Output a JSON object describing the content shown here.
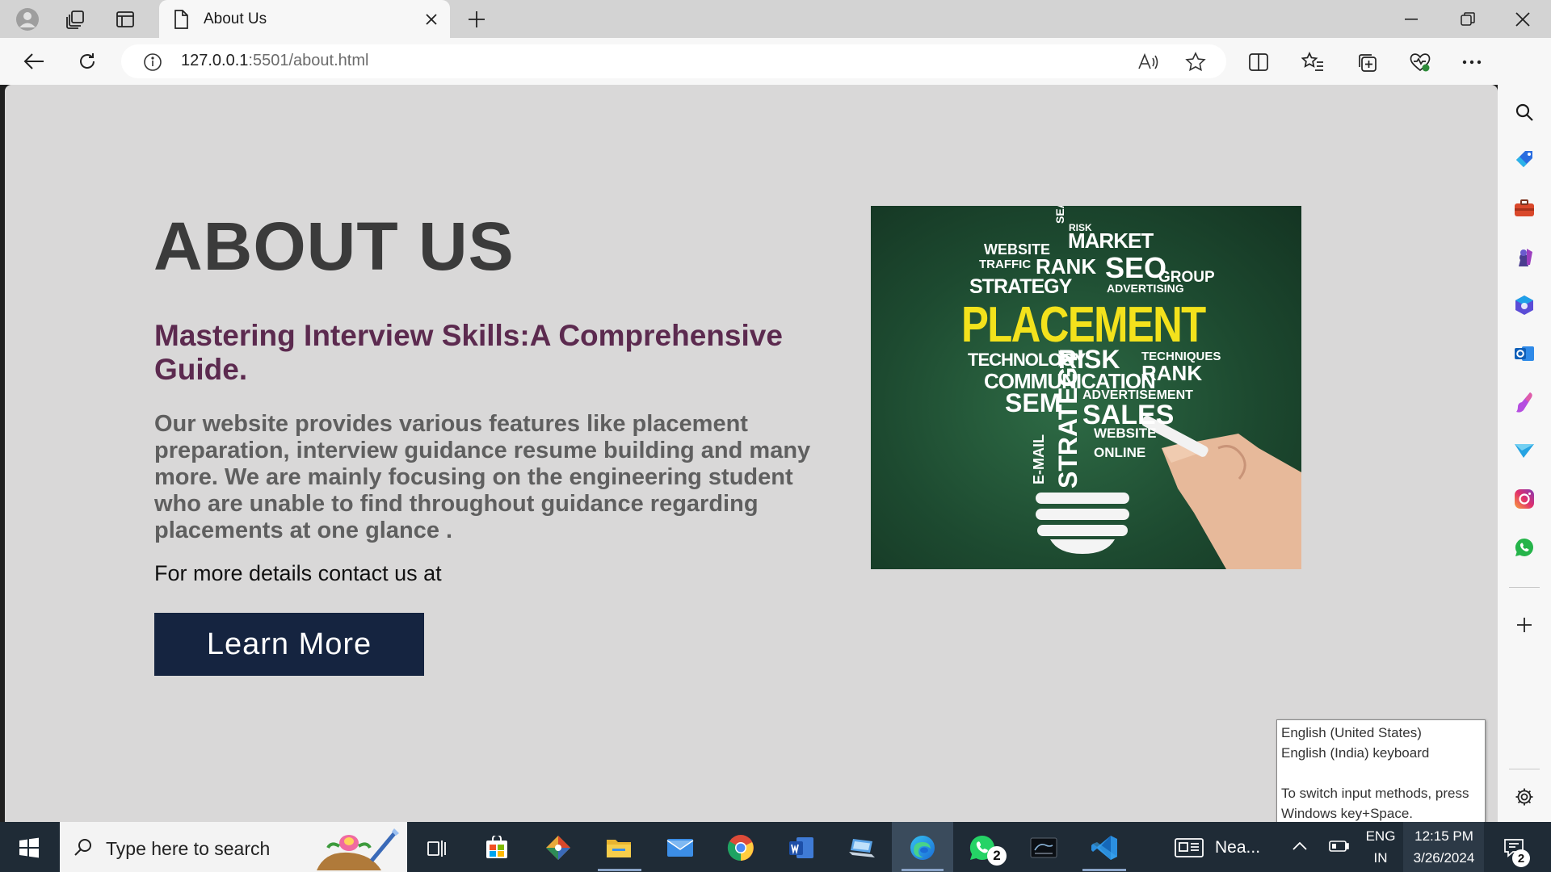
{
  "browser": {
    "tab_title": "About Us",
    "url_host": "127.0.0.1",
    "url_rest": ":5501/about.html"
  },
  "page": {
    "heading": "ABOUT US",
    "subheading": "Mastering Interview Skills:A Comprehensive Guide.",
    "description": "Our website provides various features like placement preparation, interview guidance resume building and many more. We are mainly focusing on the engineering student who are unable to find throughout guidance regarding placements at one glance .",
    "contact_text": "For more details contact us at",
    "button_label": "Learn More",
    "image": {
      "title": "PLACEMENT",
      "words_top": [
        "RISK",
        "MARKET",
        "WEBSITE",
        "RANK",
        "SEO",
        "TRAFFIC",
        "STRATEGY",
        "ADVERTISING",
        "SEARCH",
        "GROUP"
      ],
      "words_bottom": [
        "TECHNOLOGY",
        "RISK",
        "TECHNIQUES",
        "RANK",
        "COMMUNICATION",
        "SEM",
        "ADVERTISEMENT",
        "SALES",
        "STRATEGY",
        "E-MAIL",
        "WEBSITE",
        "ONLINE"
      ]
    }
  },
  "tooltip": {
    "line1": "English (United States)",
    "line2": "English (India) keyboard",
    "line3": "To switch input methods, press",
    "line4": "Windows key+Space."
  },
  "taskbar": {
    "search_placeholder": "Type here to search",
    "news_label": "Nea...",
    "language_top": "ENG",
    "language_bottom": "IN",
    "time": "12:15 PM",
    "date": "3/26/2024",
    "whatsapp_badge": "2",
    "notification_badge": "2"
  },
  "colors": {
    "page_bg": "#d9d8d8",
    "heading": "#3b3b3b",
    "subheading": "#5c2a4f",
    "button": "#152440",
    "taskbar": "#1f2b36"
  }
}
